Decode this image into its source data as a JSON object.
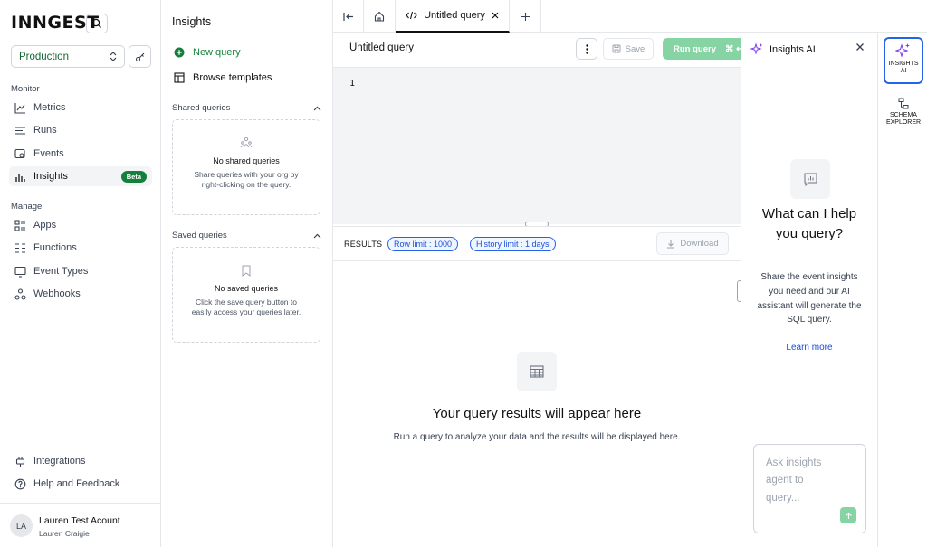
{
  "nav": {
    "logo": "INNGEST",
    "environment": "Production",
    "sections": [
      {
        "title": "Monitor",
        "items": [
          {
            "label": "Metrics",
            "icon": "chart-line-icon"
          },
          {
            "label": "Runs",
            "icon": "list-icon"
          },
          {
            "label": "Events",
            "icon": "events-icon"
          },
          {
            "label": "Insights",
            "icon": "bar-chart-icon",
            "badge": "Beta",
            "active": true
          }
        ]
      },
      {
        "title": "Manage",
        "items": [
          {
            "label": "Apps",
            "icon": "apps-icon"
          },
          {
            "label": "Functions",
            "icon": "functions-icon"
          },
          {
            "label": "Event Types",
            "icon": "event-types-icon"
          },
          {
            "label": "Webhooks",
            "icon": "webhooks-icon"
          }
        ]
      }
    ],
    "footer_items": [
      {
        "label": "Integrations",
        "icon": "plug-icon"
      },
      {
        "label": "Help and Feedback",
        "icon": "help-icon"
      }
    ],
    "user": {
      "initials": "LA",
      "name": "Lauren Test Acount",
      "sub": "Lauren Craigie"
    }
  },
  "sidebar": {
    "title": "Insights",
    "new_query": "New query",
    "browse_templates": "Browse templates",
    "shared": {
      "title": "Shared queries",
      "empty_title": "No shared queries",
      "empty_desc": "Share queries with your org by right-clicking on the query."
    },
    "saved": {
      "title": "Saved queries",
      "empty_title": "No saved queries",
      "empty_desc": "Click the save query button to easily access your queries later."
    }
  },
  "tabs": {
    "active_label": "Untitled query"
  },
  "editor": {
    "title": "Untitled query",
    "save_label": "Save",
    "run_label": "Run query",
    "run_shortcut": "⌘ ↵",
    "line_number": "1"
  },
  "results": {
    "label": "RESULTS",
    "row_limit": "Row limit : 1000",
    "history_limit": "History limit : 1 days",
    "download_label": "Download",
    "empty_title": "Your query results will appear here",
    "empty_desc": "Run a query to analyze your data and the results will be displayed here."
  },
  "ai_panel": {
    "title": "Insights AI",
    "question": "What can I help you query?",
    "description": "Share the event insights you need and our AI assistant will generate the SQL query.",
    "learn_more": "Learn more",
    "input_placeholder": "Ask insights agent to query..."
  },
  "rail": {
    "insights_ai": "INSIGHTS AI",
    "schema_explorer": "SCHEMA EXPLORER"
  },
  "colors": {
    "accent_green": "#15803d",
    "run_button": "#86d4a4",
    "pill_blue": "#2563eb"
  }
}
